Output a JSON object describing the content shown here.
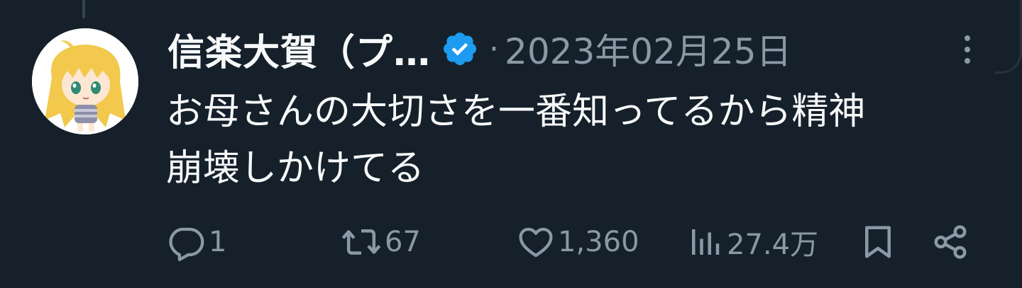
{
  "tweet": {
    "author_name": "信楽大賀（プ…",
    "separator": "·",
    "date": "2023年02月25日",
    "text": "お母さんの大切さを一番知ってるから精神\n崩壊しかけてる"
  },
  "actions": {
    "reply_count": "1",
    "retweet_count": "67",
    "like_count": "1,360",
    "views_count": "27.4万"
  },
  "icons": {
    "avatar": "anime-avatar",
    "verified": "verified-badge-icon",
    "more": "more-vertical-icon",
    "reply": "reply-icon",
    "retweet": "retweet-icon",
    "like": "heart-icon",
    "views": "views-icon",
    "bookmark": "bookmark-icon",
    "share": "share-icon"
  },
  "colors": {
    "background": "#15202b",
    "text_primary": "#f7f9f9",
    "text_secondary": "#8b98a5",
    "verified_blue": "#1d9bf0"
  }
}
